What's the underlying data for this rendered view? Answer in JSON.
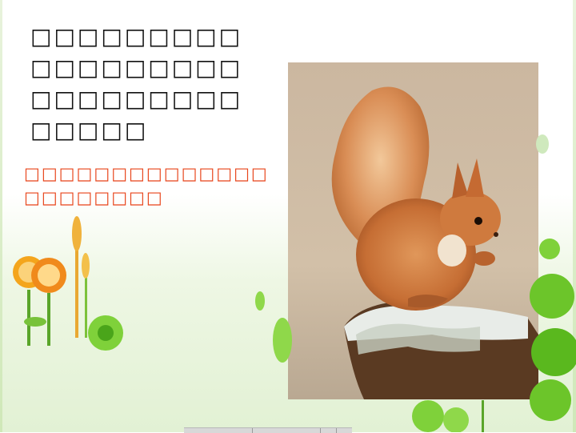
{
  "slide": {
    "paragraph": "□□□□□□□□□□□□□□□□□□□□□□□□□□□□□□□□",
    "note": "□□□□□□□□□□□□□□□□□□□□□□",
    "photo_subject": "squirrel-photo",
    "accent_colors": {
      "note_text": "#e8441a",
      "background_green": "#e2f1d4",
      "flower_green": "#6cc52a"
    }
  }
}
